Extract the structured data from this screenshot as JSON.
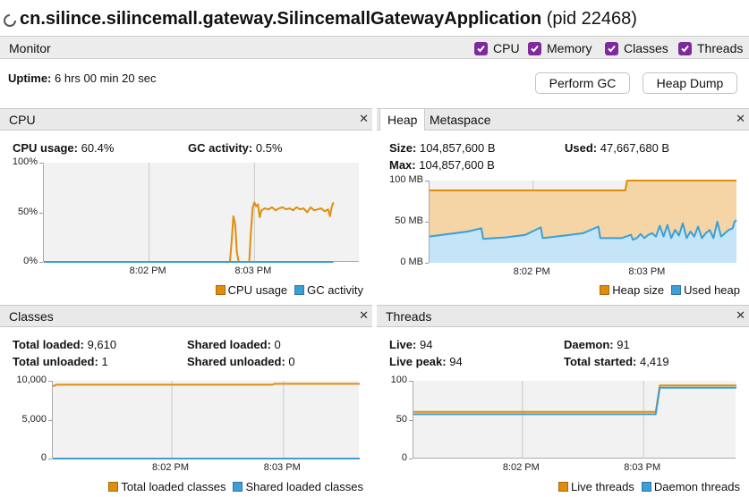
{
  "window": {
    "app_name": "cn.silince.silincemall.gateway.SilincemallGatewayApplication",
    "pid_label": "(pid 22468)"
  },
  "monitor": {
    "label": "Monitor",
    "checkboxes": [
      {
        "label": "CPU",
        "checked": true
      },
      {
        "label": "Memory",
        "checked": true
      },
      {
        "label": "Classes",
        "checked": true
      },
      {
        "label": "Threads",
        "checked": true
      }
    ],
    "uptime_label": "Uptime:",
    "uptime_value": "6 hrs 00 min 20 sec",
    "perform_gc_label": "Perform GC",
    "heap_dump_label": "Heap Dump"
  },
  "colors": {
    "orange": "#e08d0c",
    "orange_fill": "#f5d4a6",
    "blue": "#3d9ed6",
    "blue_fill": "#c3e5f7",
    "checkbox": "#7e2a9c"
  },
  "cpu_panel": {
    "title": "CPU",
    "cpu_usage_label": "CPU usage:",
    "cpu_usage_value": "60.4%",
    "gc_activity_label": "GC activity:",
    "gc_activity_value": "0.5%"
  },
  "memory_panel": {
    "tabs": [
      "Heap",
      "Metaspace"
    ],
    "size_label": "Size:",
    "size_value": "104,857,600 B",
    "used_label": "Used:",
    "used_value": "47,667,680 B",
    "max_label": "Max:",
    "max_value": "104,857,600 B"
  },
  "classes_panel": {
    "title": "Classes",
    "total_loaded_label": "Total loaded:",
    "total_loaded_value": "9,610",
    "total_unloaded_label": "Total unloaded:",
    "total_unloaded_value": "1",
    "shared_loaded_label": "Shared loaded:",
    "shared_loaded_value": "0",
    "shared_unloaded_label": "Shared unloaded:",
    "shared_unloaded_value": "0"
  },
  "threads_panel": {
    "title": "Threads",
    "live_label": "Live:",
    "live_value": "94",
    "live_peak_label": "Live peak:",
    "live_peak_value": "94",
    "daemon_label": "Daemon:",
    "daemon_value": "91",
    "total_started_label": "Total started:",
    "total_started_value": "4,419"
  },
  "chart_data": [
    {
      "id": "cpu",
      "type": "line",
      "yticks": [
        "100%",
        "50%",
        "0%"
      ],
      "ylim": [
        0,
        100
      ],
      "xticks": [
        "8:02 PM",
        "8:03 PM"
      ],
      "xlim": [
        0,
        180
      ],
      "xtick_positions": [
        60,
        120
      ],
      "series": [
        {
          "name": "CPU usage",
          "color": "#e08d0c",
          "x": [
            0,
            106,
            107,
            108,
            109,
            110,
            111,
            112,
            113,
            114,
            115,
            116,
            117,
            118,
            119,
            120,
            121,
            122,
            123,
            124,
            126,
            128,
            130,
            132,
            134,
            136,
            138,
            140,
            142,
            144,
            146,
            148,
            150,
            152,
            154,
            156,
            158,
            160,
            162,
            163,
            164,
            165
          ],
          "y": [
            0,
            0,
            20,
            46,
            38,
            10,
            0,
            0,
            0,
            0,
            0,
            0,
            0,
            30,
            55,
            60,
            56,
            58,
            45,
            52,
            54,
            53,
            55,
            52,
            54,
            55,
            53,
            54,
            52,
            55,
            53,
            54,
            50,
            55,
            52,
            53,
            54,
            51,
            53,
            46,
            55,
            60
          ]
        },
        {
          "name": "GC activity",
          "color": "#3d9ed6",
          "x": [
            0,
            165
          ],
          "y": [
            0,
            0
          ]
        }
      ]
    },
    {
      "id": "heap",
      "type": "area",
      "yticks": [
        "100 MB",
        "50 MB",
        "0 MB"
      ],
      "ylim": [
        0,
        100
      ],
      "xticks": [
        "8:02 PM",
        "8:03 PM"
      ],
      "xlim": [
        0,
        160
      ],
      "xtick_positions": [
        54,
        114
      ],
      "series": [
        {
          "name": "Heap size",
          "color": "#e08d0c",
          "fill": "#f5d4a6",
          "x": [
            0,
            102,
            103,
            160
          ],
          "y": [
            88,
            88,
            100,
            100
          ]
        },
        {
          "name": "Used heap",
          "color": "#3d9ed6",
          "fill": "#c3e5f7",
          "x": [
            0,
            10,
            20,
            27,
            28,
            40,
            50,
            58,
            59,
            70,
            80,
            88,
            89,
            100,
            105,
            106,
            108,
            110,
            112,
            114,
            116,
            118,
            120,
            122,
            124,
            126,
            128,
            130,
            132,
            134,
            136,
            138,
            140,
            142,
            144,
            146,
            148,
            150,
            152,
            154,
            156,
            158,
            159,
            160
          ],
          "y": [
            32,
            35,
            38,
            42,
            29,
            31,
            34,
            43,
            30,
            33,
            36,
            44,
            30,
            30,
            34,
            28,
            30,
            35,
            30,
            34,
            36,
            32,
            45,
            32,
            46,
            30,
            40,
            33,
            48,
            30,
            38,
            32,
            44,
            30,
            36,
            40,
            30,
            50,
            32,
            36,
            40,
            42,
            50,
            52
          ]
        }
      ]
    },
    {
      "id": "classes",
      "type": "line",
      "yticks": [
        "10,000",
        "5,000",
        "0"
      ],
      "ylim": [
        0,
        10000
      ],
      "xticks": [
        "8:02 PM",
        "8:03 PM"
      ],
      "xlim": [
        0,
        165
      ],
      "xtick_positions": [
        64,
        124
      ],
      "series": [
        {
          "name": "Total loaded classes",
          "color": "#e08d0c",
          "x": [
            0,
            2,
            118,
            119,
            165
          ],
          "y": [
            9300,
            9500,
            9500,
            9610,
            9610
          ]
        },
        {
          "name": "Shared loaded classes",
          "color": "#3d9ed6",
          "x": [
            0,
            165
          ],
          "y": [
            0,
            0
          ]
        }
      ]
    },
    {
      "id": "threads",
      "type": "line",
      "yticks": [
        "100",
        "50",
        "0"
      ],
      "ylim": [
        0,
        100
      ],
      "xticks": [
        "8:02 PM",
        "8:03 PM"
      ],
      "xlim": [
        0,
        160
      ],
      "xtick_positions": [
        54,
        114
      ],
      "series": [
        {
          "name": "Live threads",
          "color": "#e08d0c",
          "x": [
            0,
            120,
            122,
            160
          ],
          "y": [
            60,
            60,
            94,
            94
          ]
        },
        {
          "name": "Daemon threads",
          "color": "#3d9ed6",
          "x": [
            0,
            120,
            122,
            160
          ],
          "y": [
            57,
            57,
            91,
            91
          ]
        }
      ]
    }
  ]
}
